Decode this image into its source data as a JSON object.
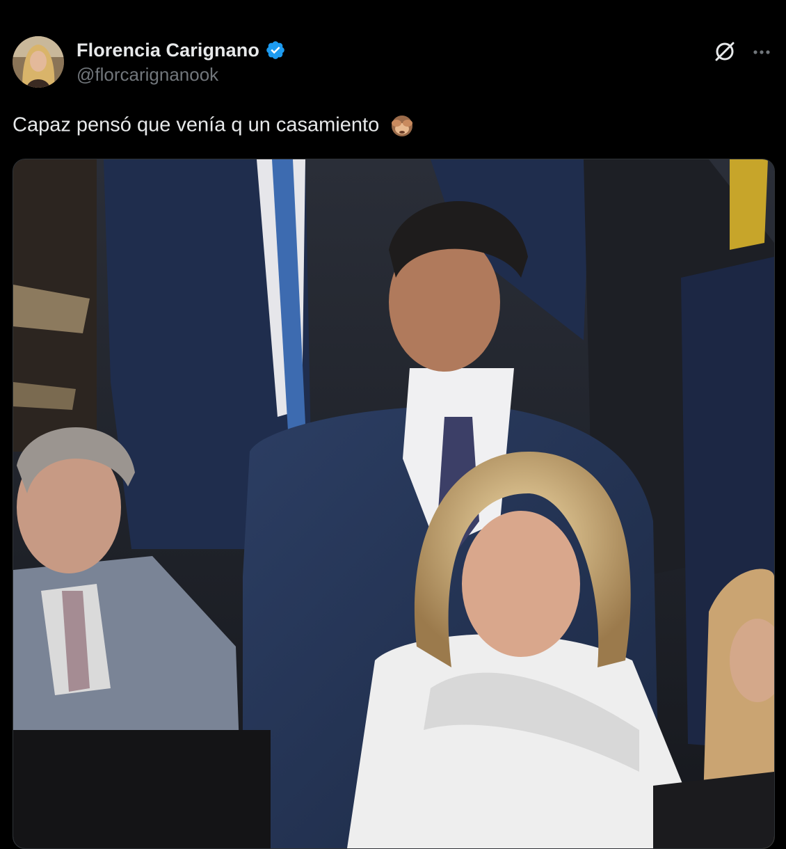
{
  "post": {
    "author": {
      "display_name": "Florencia Carignano",
      "handle": "@florcarignanook",
      "verified": true,
      "avatar_icon": "profile-photo"
    },
    "text": "Capaz pensó que venía q un casamiento",
    "emoji_icon": "see-no-evil-monkey-emoji",
    "media_icon": "photo",
    "actions": {
      "grok_icon": "grok-icon",
      "more_icon": "more-options-icon"
    }
  },
  "colors": {
    "background": "#000000",
    "text_primary": "#e7e9ea",
    "text_secondary": "#71767b",
    "verified_blue": "#1d9bf0"
  }
}
